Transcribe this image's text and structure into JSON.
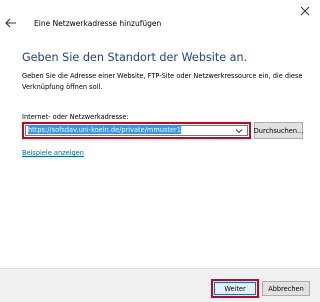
{
  "window": {
    "title": "Eine Netzwerkadresse hinzufügen",
    "back_icon": "back-arrow-icon",
    "close_icon": "close-icon"
  },
  "main": {
    "heading": "Geben Sie den Standort der Website an.",
    "description": "Geben Sie die Adresse einer Website, FTP-Site oder Netzwerkressource ein, die diese Verknüpfung öffnen soll.",
    "address_label": "Internet- oder Netzwerkadresse:",
    "address_value": "https://sofsdav.uni-koeln.de/private/mmuster1",
    "browse_label": "Durchsuchen...",
    "examples_link": "Beispiele anzeigen"
  },
  "footer": {
    "next_label": "Weiter",
    "cancel_label": "Abbrechen"
  },
  "colors": {
    "heading": "#1c3fa4",
    "highlight": "#d0021b",
    "selection": "#3297fd",
    "link": "#0066cc"
  }
}
